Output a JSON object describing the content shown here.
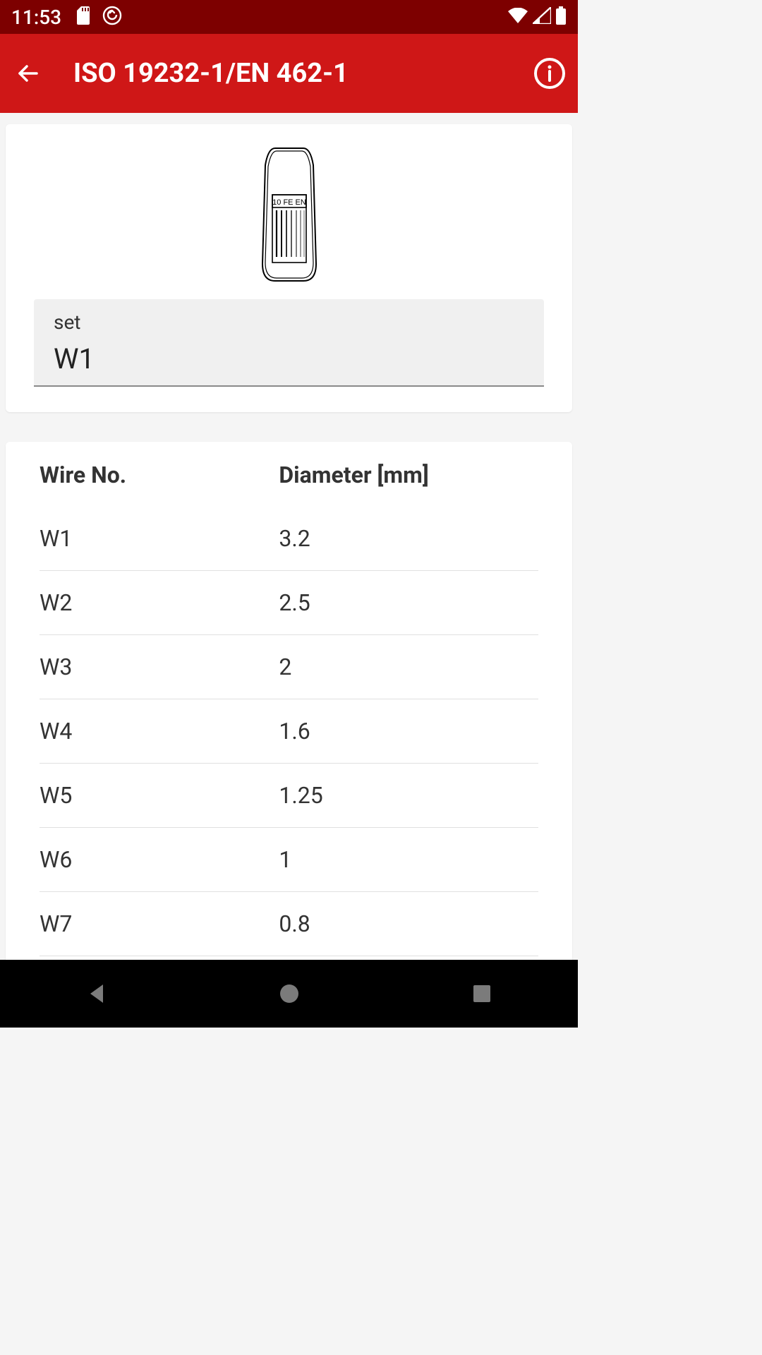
{
  "status": {
    "time": "11:53"
  },
  "header": {
    "title": "ISO 19232-1/EN 462-1"
  },
  "illustration": {
    "label": "10 FE EN"
  },
  "set_field": {
    "label": "set",
    "value": "W1"
  },
  "table": {
    "headers": {
      "wire": "Wire No.",
      "diameter": "Diameter [mm]"
    },
    "rows": [
      {
        "wire": "W1",
        "diameter": "3.2"
      },
      {
        "wire": "W2",
        "diameter": "2.5"
      },
      {
        "wire": "W3",
        "diameter": "2"
      },
      {
        "wire": "W4",
        "diameter": "1.6"
      },
      {
        "wire": "W5",
        "diameter": "1.25"
      },
      {
        "wire": "W6",
        "diameter": "1"
      },
      {
        "wire": "W7",
        "diameter": "0.8"
      }
    ]
  }
}
